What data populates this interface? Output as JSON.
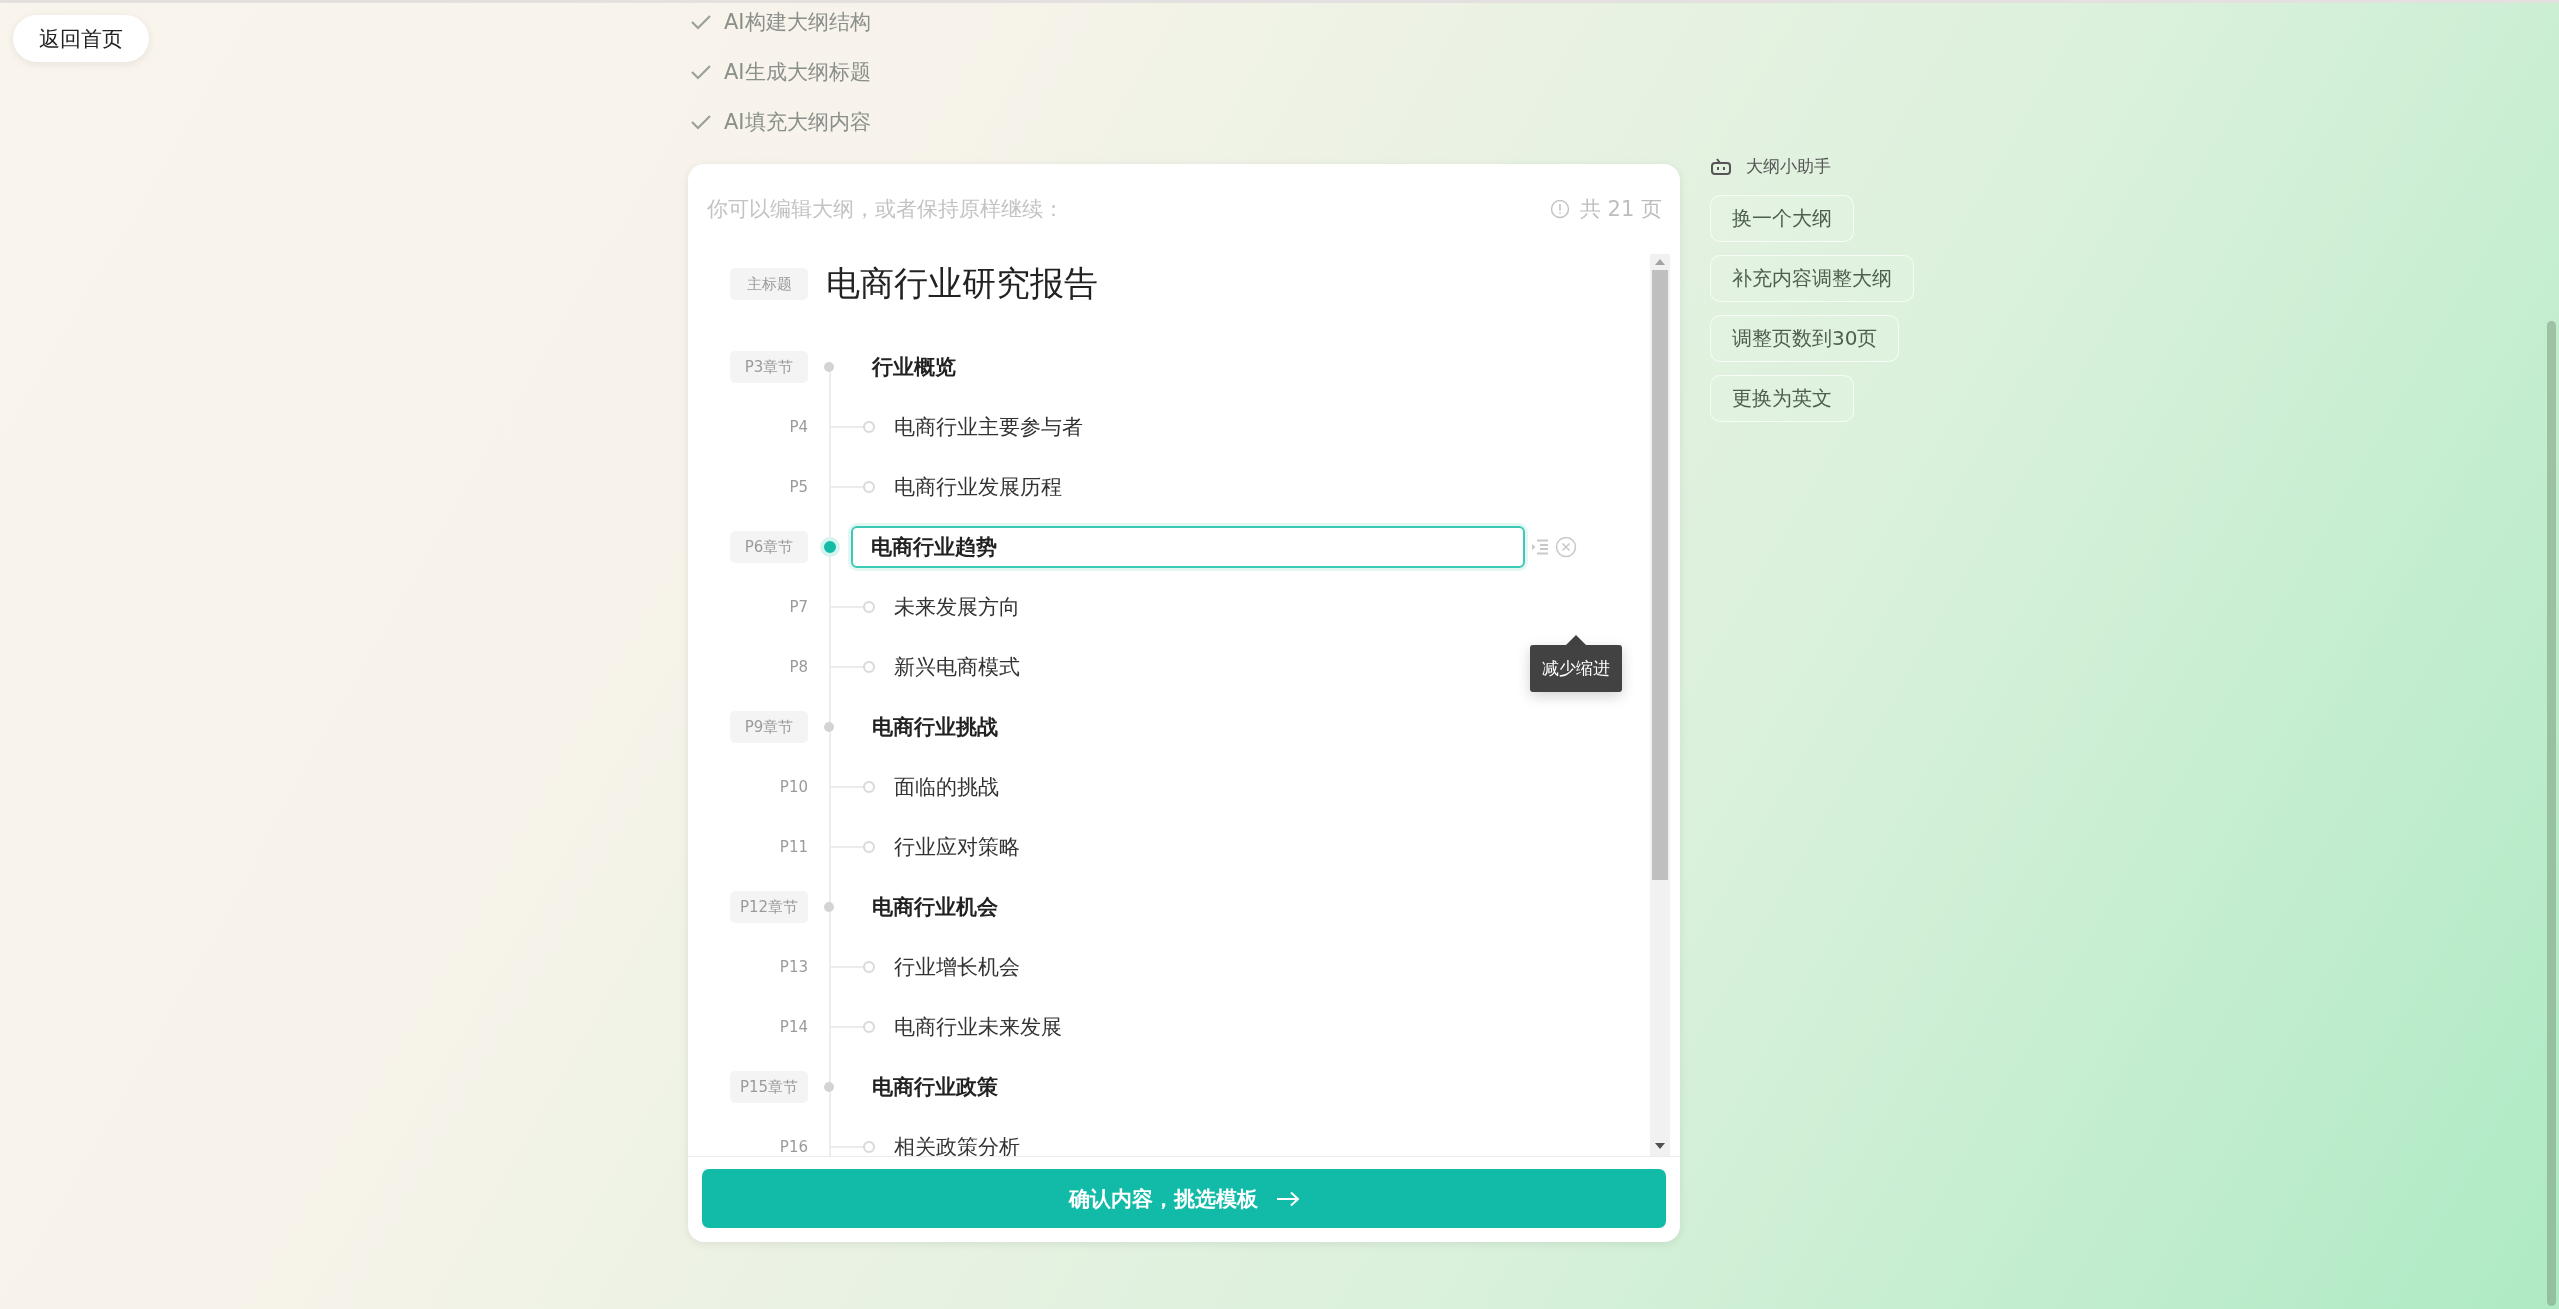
{
  "back_button": "返回首页",
  "steps": [
    {
      "label": "AI构建大纲结构",
      "done": true
    },
    {
      "label": "AI生成大纲标题",
      "done": true
    },
    {
      "label": "AI填充大纲内容",
      "done": true
    }
  ],
  "outline_card": {
    "hint": "你可以编辑大纲，或者保持原样继续：",
    "page_count": "共 21 页",
    "title_tag": "主标题",
    "title": "电商行业研究报告",
    "chapters": [
      {
        "tag": "P3章节",
        "title": "行业概览",
        "editing": false,
        "children": [
          {
            "tag": "P4",
            "title": "电商行业主要参与者"
          },
          {
            "tag": "P5",
            "title": "电商行业发展历程"
          }
        ]
      },
      {
        "tag": "P6章节",
        "title": "电商行业趋势",
        "editing": true,
        "tooltip": "减少缩进",
        "children": [
          {
            "tag": "P7",
            "title": "未来发展方向"
          },
          {
            "tag": "P8",
            "title": "新兴电商模式"
          }
        ]
      },
      {
        "tag": "P9章节",
        "title": "电商行业挑战",
        "editing": false,
        "children": [
          {
            "tag": "P10",
            "title": "面临的挑战"
          },
          {
            "tag": "P11",
            "title": "行业应对策略"
          }
        ]
      },
      {
        "tag": "P12章节",
        "title": "电商行业机会",
        "editing": false,
        "children": [
          {
            "tag": "P13",
            "title": "行业增长机会"
          },
          {
            "tag": "P14",
            "title": "电商行业未来发展"
          }
        ]
      },
      {
        "tag": "P15章节",
        "title": "电商行业政策",
        "editing": false,
        "children": [
          {
            "tag": "P16",
            "title": "相关政策分析"
          }
        ]
      }
    ],
    "confirm_button": "确认内容，挑选模板"
  },
  "assistant": {
    "title": "大纲小助手",
    "actions": [
      "换一个大纲",
      "补充内容调整大纲",
      "调整页数到30页",
      "更换为英文"
    ]
  }
}
